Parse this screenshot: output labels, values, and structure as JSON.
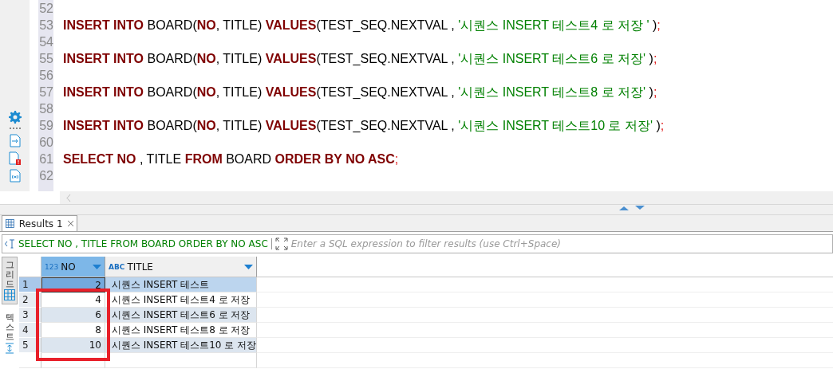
{
  "editor": {
    "lines": [
      {
        "number": "52"
      },
      {
        "number": "53",
        "tokens": [
          {
            "kind": "keyword",
            "text": "INSERT INTO"
          },
          {
            "kind": "plain",
            "text": " BOARD("
          },
          {
            "kind": "keyword",
            "text": "NO"
          },
          {
            "kind": "plain",
            "text": ", TITLE) "
          },
          {
            "kind": "keyword",
            "text": "VALUES"
          },
          {
            "kind": "plain",
            "text": "(TEST_SEQ.NEXTVAL , "
          },
          {
            "kind": "string",
            "text": "'시퀀스 INSERT 테스트4 로 저장 '"
          },
          {
            "kind": "plain",
            "text": " )"
          },
          {
            "kind": "punct",
            "text": ";"
          }
        ]
      },
      {
        "number": "54"
      },
      {
        "number": "55",
        "tokens": [
          {
            "kind": "keyword",
            "text": "INSERT INTO"
          },
          {
            "kind": "plain",
            "text": " BOARD("
          },
          {
            "kind": "keyword",
            "text": "NO"
          },
          {
            "kind": "plain",
            "text": ", TITLE) "
          },
          {
            "kind": "keyword",
            "text": "VALUES"
          },
          {
            "kind": "plain",
            "text": "(TEST_SEQ.NEXTVAL , "
          },
          {
            "kind": "string",
            "text": "'시퀀스 INSERT 테스트6 로 저장'"
          },
          {
            "kind": "plain",
            "text": " )"
          },
          {
            "kind": "punct",
            "text": ";"
          }
        ]
      },
      {
        "number": "56"
      },
      {
        "number": "57",
        "tokens": [
          {
            "kind": "keyword",
            "text": "INSERT INTO"
          },
          {
            "kind": "plain",
            "text": " BOARD("
          },
          {
            "kind": "keyword",
            "text": "NO"
          },
          {
            "kind": "plain",
            "text": ", TITLE) "
          },
          {
            "kind": "keyword",
            "text": "VALUES"
          },
          {
            "kind": "plain",
            "text": "(TEST_SEQ.NEXTVAL , "
          },
          {
            "kind": "string",
            "text": "'시퀀스 INSERT 테스트8 로 저장'"
          },
          {
            "kind": "plain",
            "text": " )"
          },
          {
            "kind": "punct",
            "text": ";"
          }
        ]
      },
      {
        "number": "58"
      },
      {
        "number": "59",
        "tokens": [
          {
            "kind": "keyword",
            "text": "INSERT INTO"
          },
          {
            "kind": "plain",
            "text": " BOARD("
          },
          {
            "kind": "keyword",
            "text": "NO"
          },
          {
            "kind": "plain",
            "text": ", TITLE) "
          },
          {
            "kind": "keyword",
            "text": "VALUES"
          },
          {
            "kind": "plain",
            "text": "(TEST_SEQ.NEXTVAL , "
          },
          {
            "kind": "string",
            "text": "'시퀀스 INSERT 테스트10 로 저장'"
          },
          {
            "kind": "plain",
            "text": " )"
          },
          {
            "kind": "punct",
            "text": ";"
          }
        ]
      },
      {
        "number": "60"
      },
      {
        "number": "61",
        "tokens": [
          {
            "kind": "keyword",
            "text": "SELECT NO"
          },
          {
            "kind": "plain",
            "text": " , TITLE "
          },
          {
            "kind": "keyword",
            "text": "FROM"
          },
          {
            "kind": "plain",
            "text": " BOARD "
          },
          {
            "kind": "keyword",
            "text": "ORDER BY NO ASC"
          },
          {
            "kind": "punct",
            "text": ";"
          }
        ]
      },
      {
        "number": "62"
      }
    ]
  },
  "results": {
    "tabs": [
      {
        "label": "Results 1",
        "selected": true
      }
    ],
    "filter": {
      "query": "SELECT NO , TITLE FROM BOARD ORDER BY NO ASC",
      "placeholder": "Enter a SQL expression to filter results (use Ctrl+Space)"
    },
    "view_modes": [
      {
        "label": "그리드",
        "selected": true
      },
      {
        "label": "텍스트",
        "selected": false
      }
    ],
    "columns": [
      {
        "type_badge": "123",
        "name": "NO",
        "selected": true
      },
      {
        "type_badge": "ABC",
        "name": "TITLE",
        "selected": false
      }
    ],
    "rows": [
      {
        "number": "1",
        "no": "2",
        "title": "시퀀스 INSERT 테스트",
        "selected": true
      },
      {
        "number": "2",
        "no": "4",
        "title": "시퀀스 INSERT 테스트4 로 저장",
        "selected": false
      },
      {
        "number": "3",
        "no": "6",
        "title": "시퀀스 INSERT 테스트6 로 저장",
        "selected": false
      },
      {
        "number": "4",
        "no": "8",
        "title": "시퀀스 INSERT 테스트8 로 저장",
        "selected": false
      },
      {
        "number": "5",
        "no": "10",
        "title": "시퀀스 INSERT 테스트10 로 저장",
        "selected": false
      }
    ]
  }
}
